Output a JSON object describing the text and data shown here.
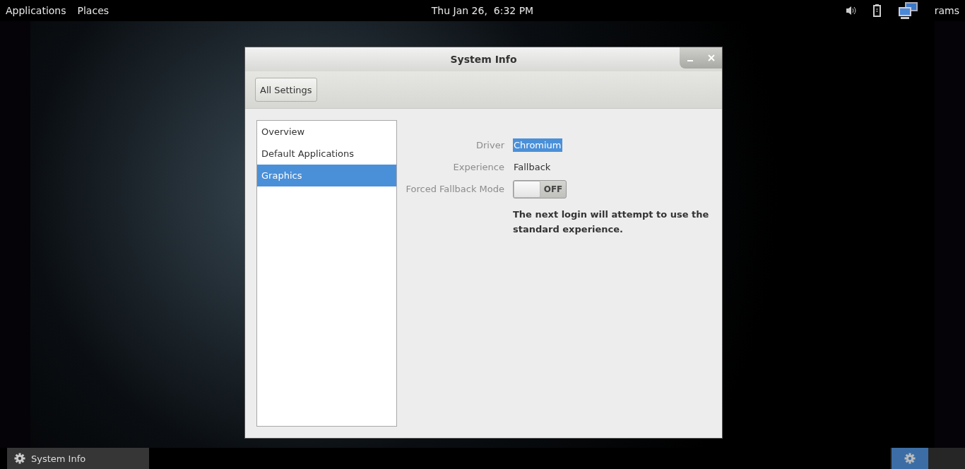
{
  "top_bar": {
    "menus": [
      "Applications",
      "Places"
    ],
    "clock": "Thu Jan 26,  6:32 PM",
    "user": "rams"
  },
  "window": {
    "title": "System Info",
    "toolbar_button": "All Settings",
    "sidebar": {
      "items": [
        {
          "label": "Overview",
          "selected": false
        },
        {
          "label": "Default Applications",
          "selected": false
        },
        {
          "label": "Graphics",
          "selected": true
        }
      ]
    },
    "rows": [
      {
        "kind": "text",
        "label": "Driver",
        "value": "Chromium",
        "highlighted": true
      },
      {
        "kind": "text",
        "label": "Experience",
        "value": "Fallback",
        "highlighted": false
      },
      {
        "kind": "switch",
        "label": "Forced Fallback Mode",
        "on": false,
        "state_text": "OFF"
      }
    ],
    "note": "The next login will attempt to use the standard experience."
  },
  "taskbar": {
    "tasks": [
      {
        "label": "System Info"
      }
    ],
    "workspaces": [
      {
        "selected": true
      },
      {
        "selected": false
      }
    ]
  }
}
